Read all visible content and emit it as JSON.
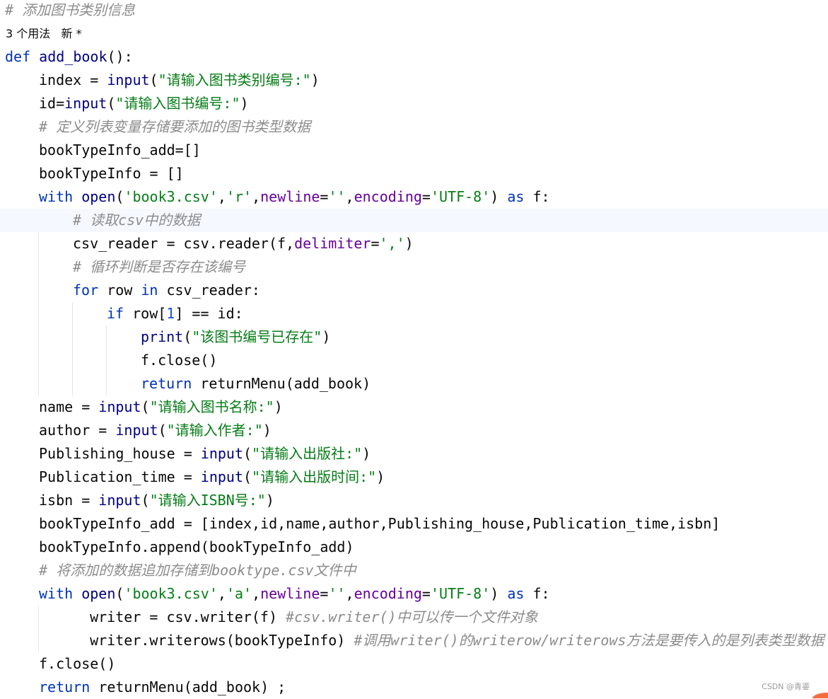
{
  "editor": {
    "lines": [
      {
        "kind": "code",
        "indent": 0,
        "tokens": [
          {
            "text": "# 添加图书类别信息",
            "type": "comment"
          }
        ]
      },
      {
        "kind": "meta",
        "indent": 0,
        "tokens": [
          {
            "text": "3 个用法   新 *",
            "type": "plain"
          }
        ]
      },
      {
        "kind": "code",
        "indent": 0,
        "tokens": [
          {
            "text": "def ",
            "type": "kw"
          },
          {
            "text": "add_book",
            "type": "fn"
          },
          {
            "text": "():",
            "type": "plain"
          }
        ]
      },
      {
        "kind": "code",
        "indent": 1,
        "tokens": [
          {
            "text": "index = ",
            "type": "plain"
          },
          {
            "text": "input",
            "type": "builtin"
          },
          {
            "text": "(",
            "type": "plain"
          },
          {
            "text": "\"请输入图书类别编号:\"",
            "type": "str"
          },
          {
            "text": ")",
            "type": "plain"
          }
        ]
      },
      {
        "kind": "code",
        "indent": 1,
        "tokens": [
          {
            "text": "id=",
            "type": "plain"
          },
          {
            "text": "input",
            "type": "builtin"
          },
          {
            "text": "(",
            "type": "plain"
          },
          {
            "text": "\"请输入图书编号:\"",
            "type": "str"
          },
          {
            "text": ")",
            "type": "plain"
          }
        ]
      },
      {
        "kind": "code",
        "indent": 1,
        "tokens": [
          {
            "text": "# 定义列表变量存储要添加的图书类型数据",
            "type": "comment"
          }
        ]
      },
      {
        "kind": "code",
        "indent": 1,
        "tokens": [
          {
            "text": "bookTypeInfo_add=[]",
            "type": "plain"
          }
        ]
      },
      {
        "kind": "code",
        "indent": 1,
        "tokens": [
          {
            "text": "bookTypeInfo = []",
            "type": "plain"
          }
        ]
      },
      {
        "kind": "code",
        "indent": 1,
        "tokens": [
          {
            "text": "with ",
            "type": "kw"
          },
          {
            "text": "open",
            "type": "builtin"
          },
          {
            "text": "(",
            "type": "plain"
          },
          {
            "text": "'book3.csv'",
            "type": "str"
          },
          {
            "text": ",",
            "type": "plain"
          },
          {
            "text": "'r'",
            "type": "str"
          },
          {
            "text": ",",
            "type": "plain"
          },
          {
            "text": "newline",
            "type": "param"
          },
          {
            "text": "=",
            "type": "plain"
          },
          {
            "text": "''",
            "type": "str"
          },
          {
            "text": ",",
            "type": "plain"
          },
          {
            "text": "encoding",
            "type": "param"
          },
          {
            "text": "=",
            "type": "plain"
          },
          {
            "text": "'UTF-8'",
            "type": "str"
          },
          {
            "text": ") ",
            "type": "plain"
          },
          {
            "text": "as ",
            "type": "kw"
          },
          {
            "text": "f:",
            "type": "plain"
          }
        ]
      },
      {
        "kind": "code",
        "indent": 2,
        "current": true,
        "tokens": [
          {
            "text": "# 读取csv中的数据",
            "type": "comment"
          }
        ]
      },
      {
        "kind": "code",
        "indent": 2,
        "tokens": [
          {
            "text": "csv_reader = csv.reader(f,",
            "type": "plain"
          },
          {
            "text": "delimiter",
            "type": "param"
          },
          {
            "text": "=",
            "type": "plain"
          },
          {
            "text": "','",
            "type": "str"
          },
          {
            "text": ")",
            "type": "plain"
          }
        ]
      },
      {
        "kind": "code",
        "indent": 2,
        "tokens": [
          {
            "text": "# 循环判断是否存在该编号",
            "type": "comment"
          }
        ]
      },
      {
        "kind": "code",
        "indent": 2,
        "tokens": [
          {
            "text": "for ",
            "type": "kw"
          },
          {
            "text": "row ",
            "type": "plain"
          },
          {
            "text": "in ",
            "type": "kw"
          },
          {
            "text": "csv_reader:",
            "type": "plain"
          }
        ]
      },
      {
        "kind": "code",
        "indent": 3,
        "tokens": [
          {
            "text": "if ",
            "type": "kw"
          },
          {
            "text": "row[",
            "type": "plain"
          },
          {
            "text": "1",
            "type": "num"
          },
          {
            "text": "] == id:",
            "type": "plain"
          }
        ]
      },
      {
        "kind": "code",
        "indent": 4,
        "tokens": [
          {
            "text": "print",
            "type": "builtin"
          },
          {
            "text": "(",
            "type": "plain"
          },
          {
            "text": "\"该图书编号已存在\"",
            "type": "str"
          },
          {
            "text": ")",
            "type": "plain"
          }
        ]
      },
      {
        "kind": "code",
        "indent": 4,
        "tokens": [
          {
            "text": "f.close()",
            "type": "plain"
          }
        ]
      },
      {
        "kind": "code",
        "indent": 4,
        "tokens": [
          {
            "text": "return ",
            "type": "kw"
          },
          {
            "text": "returnMenu(add_book)",
            "type": "plain"
          }
        ]
      },
      {
        "kind": "code",
        "indent": 1,
        "tokens": [
          {
            "text": "name = ",
            "type": "plain"
          },
          {
            "text": "input",
            "type": "builtin"
          },
          {
            "text": "(",
            "type": "plain"
          },
          {
            "text": "\"请输入图书名称:\"",
            "type": "str"
          },
          {
            "text": ")",
            "type": "plain"
          }
        ]
      },
      {
        "kind": "code",
        "indent": 1,
        "tokens": [
          {
            "text": "author = ",
            "type": "plain"
          },
          {
            "text": "input",
            "type": "builtin"
          },
          {
            "text": "(",
            "type": "plain"
          },
          {
            "text": "\"请输入作者:\"",
            "type": "str"
          },
          {
            "text": ")",
            "type": "plain"
          }
        ]
      },
      {
        "kind": "code",
        "indent": 1,
        "tokens": [
          {
            "text": "Publishing_house = ",
            "type": "plain"
          },
          {
            "text": "input",
            "type": "builtin"
          },
          {
            "text": "(",
            "type": "plain"
          },
          {
            "text": "\"请输入出版社:\"",
            "type": "str"
          },
          {
            "text": ")",
            "type": "plain"
          }
        ]
      },
      {
        "kind": "code",
        "indent": 1,
        "tokens": [
          {
            "text": "Publication_time = ",
            "type": "plain"
          },
          {
            "text": "input",
            "type": "builtin"
          },
          {
            "text": "(",
            "type": "plain"
          },
          {
            "text": "\"请输入出版时间:\"",
            "type": "str"
          },
          {
            "text": ")",
            "type": "plain"
          }
        ]
      },
      {
        "kind": "code",
        "indent": 1,
        "tokens": [
          {
            "text": "isbn = ",
            "type": "plain"
          },
          {
            "text": "input",
            "type": "builtin"
          },
          {
            "text": "(",
            "type": "plain"
          },
          {
            "text": "\"请输入ISBN号:\"",
            "type": "str"
          },
          {
            "text": ")",
            "type": "plain"
          }
        ]
      },
      {
        "kind": "code",
        "indent": 1,
        "tokens": [
          {
            "text": "bookTypeInfo_add = [index,id,name,author,Publishing_house,Publication_time,isbn]",
            "type": "plain"
          }
        ]
      },
      {
        "kind": "code",
        "indent": 1,
        "tokens": [
          {
            "text": "bookTypeInfo.append(bookTypeInfo_add)",
            "type": "plain"
          }
        ]
      },
      {
        "kind": "code",
        "indent": 1,
        "tokens": [
          {
            "text": "# 将添加的数据追加存储到booktype.csv文件中",
            "type": "comment"
          }
        ]
      },
      {
        "kind": "code",
        "indent": 1,
        "tokens": [
          {
            "text": "with ",
            "type": "kw"
          },
          {
            "text": "open",
            "type": "builtin"
          },
          {
            "text": "(",
            "type": "plain"
          },
          {
            "text": "'book3.csv'",
            "type": "str"
          },
          {
            "text": ",",
            "type": "plain"
          },
          {
            "text": "'a'",
            "type": "str"
          },
          {
            "text": ",",
            "type": "plain"
          },
          {
            "text": "newline",
            "type": "param"
          },
          {
            "text": "=",
            "type": "plain"
          },
          {
            "text": "''",
            "type": "str"
          },
          {
            "text": ",",
            "type": "plain"
          },
          {
            "text": "encoding",
            "type": "param"
          },
          {
            "text": "=",
            "type": "plain"
          },
          {
            "text": "'UTF-8'",
            "type": "str"
          },
          {
            "text": ") ",
            "type": "plain"
          },
          {
            "text": "as ",
            "type": "kw"
          },
          {
            "text": "f:",
            "type": "plain"
          }
        ]
      },
      {
        "kind": "code",
        "indent": 2,
        "tokens": [
          {
            "text": "  writer = csv.writer(f) ",
            "type": "plain"
          },
          {
            "text": "#csv.writer()中可以传一个文件对象",
            "type": "comment"
          }
        ]
      },
      {
        "kind": "code",
        "indent": 2,
        "tokens": [
          {
            "text": "  writer.writerows(bookTypeInfo) ",
            "type": "plain"
          },
          {
            "text": "#调用writer()的writerow/writerows方法是要传入的是列表类型数据",
            "type": "comment"
          }
        ]
      },
      {
        "kind": "code",
        "indent": 1,
        "tokens": [
          {
            "text": "f.close()",
            "type": "plain"
          }
        ]
      },
      {
        "kind": "code",
        "indent": 1,
        "tokens": [
          {
            "text": "return ",
            "type": "kw"
          },
          {
            "text": "returnMenu(add_book) ;",
            "type": "plain"
          }
        ]
      }
    ]
  },
  "watermark": {
    "text": "CSDN @青鎏"
  },
  "colors": {
    "keyword": "#0033b3",
    "builtin": "#000080",
    "string": "#067d17",
    "number": "#1750eb",
    "parameter": "#660099",
    "comment": "#8c8c8c",
    "current_line": "#f5f8fe",
    "accent": "#f26d3d"
  }
}
